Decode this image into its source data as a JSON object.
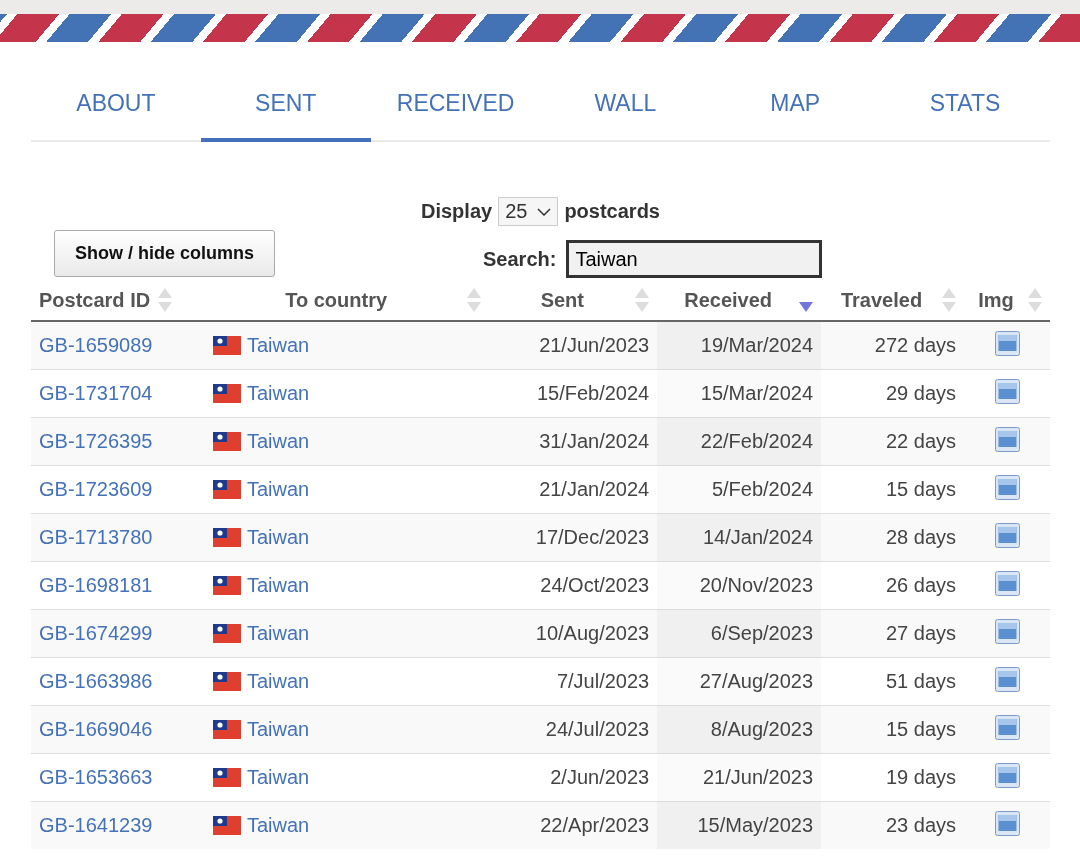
{
  "tabs": [
    {
      "label": "ABOUT",
      "selected": false
    },
    {
      "label": "SENT",
      "selected": true
    },
    {
      "label": "RECEIVED",
      "selected": false
    },
    {
      "label": "WALL",
      "selected": false
    },
    {
      "label": "MAP",
      "selected": false
    },
    {
      "label": "STATS",
      "selected": false
    }
  ],
  "controls": {
    "display_label": "Display",
    "display_value": "25",
    "display_suffix": "postcards",
    "columns_button": "Show / hide columns",
    "search_label": "Search:",
    "search_value": "Taiwan"
  },
  "table": {
    "columns": [
      {
        "label": "Postcard ID",
        "sorted": false
      },
      {
        "label": "To country",
        "sorted": false
      },
      {
        "label": "Sent",
        "sorted": false
      },
      {
        "label": "Received",
        "sorted": true
      },
      {
        "label": "Traveled",
        "sorted": false
      },
      {
        "label": "Img",
        "sorted": false
      }
    ],
    "rows": [
      {
        "id": "GB-1659089",
        "country": "Taiwan",
        "sent": "21/Jun/2023",
        "received": "19/Mar/2024",
        "traveled": "272 days"
      },
      {
        "id": "GB-1731704",
        "country": "Taiwan",
        "sent": "15/Feb/2024",
        "received": "15/Mar/2024",
        "traveled": "29 days"
      },
      {
        "id": "GB-1726395",
        "country": "Taiwan",
        "sent": "31/Jan/2024",
        "received": "22/Feb/2024",
        "traveled": "22 days"
      },
      {
        "id": "GB-1723609",
        "country": "Taiwan",
        "sent": "21/Jan/2024",
        "received": "5/Feb/2024",
        "traveled": "15 days"
      },
      {
        "id": "GB-1713780",
        "country": "Taiwan",
        "sent": "17/Dec/2023",
        "received": "14/Jan/2024",
        "traveled": "28 days"
      },
      {
        "id": "GB-1698181",
        "country": "Taiwan",
        "sent": "24/Oct/2023",
        "received": "20/Nov/2023",
        "traveled": "26 days"
      },
      {
        "id": "GB-1674299",
        "country": "Taiwan",
        "sent": "10/Aug/2023",
        "received": "6/Sep/2023",
        "traveled": "27 days"
      },
      {
        "id": "GB-1663986",
        "country": "Taiwan",
        "sent": "7/Jul/2023",
        "received": "27/Aug/2023",
        "traveled": "51 days"
      },
      {
        "id": "GB-1669046",
        "country": "Taiwan",
        "sent": "24/Jul/2023",
        "received": "8/Aug/2023",
        "traveled": "15 days"
      },
      {
        "id": "GB-1653663",
        "country": "Taiwan",
        "sent": "2/Jun/2023",
        "received": "21/Jun/2023",
        "traveled": "19 days"
      },
      {
        "id": "GB-1641239",
        "country": "Taiwan",
        "sent": "22/Apr/2023",
        "received": "15/May/2023",
        "traveled": "23 days"
      }
    ]
  }
}
